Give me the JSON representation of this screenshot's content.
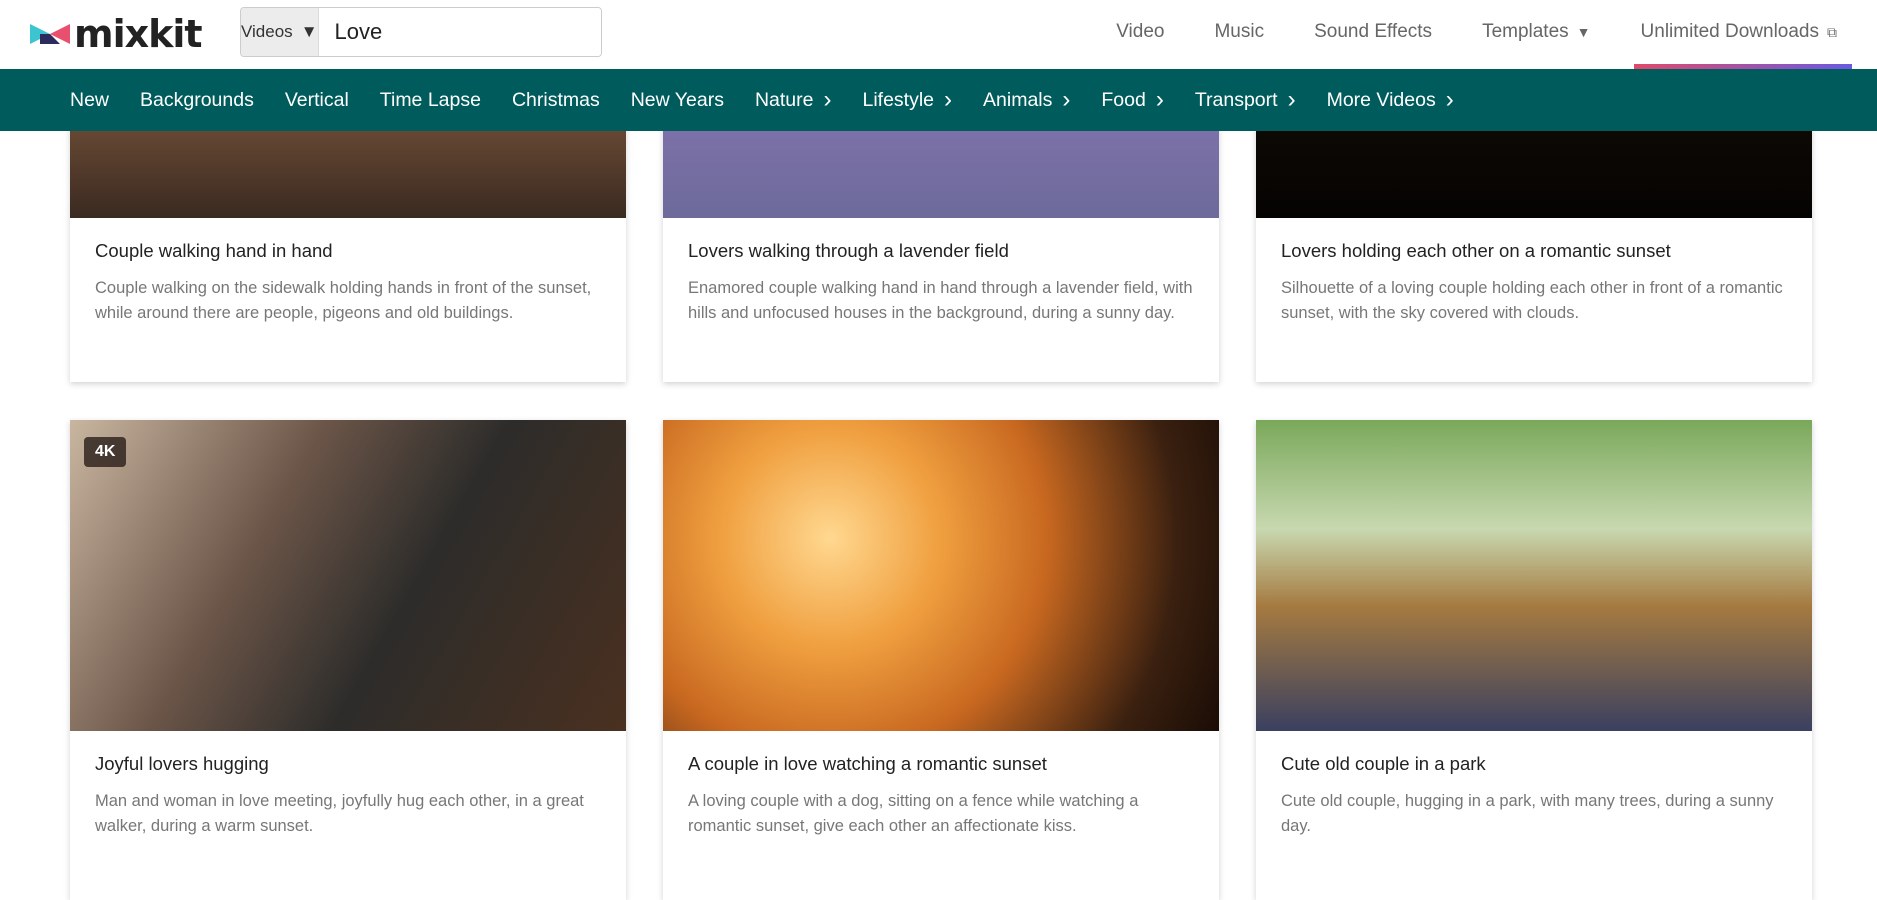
{
  "header": {
    "logo": "mixkit",
    "search": {
      "type": "Videos",
      "value": "Love"
    },
    "nav": [
      {
        "label": "Video"
      },
      {
        "label": "Music"
      },
      {
        "label": "Sound Effects"
      },
      {
        "label": "Templates"
      },
      {
        "label": "Unlimited Downloads"
      }
    ]
  },
  "categories": [
    "New",
    "Backgrounds",
    "Vertical",
    "Time Lapse",
    "Christmas",
    "New Years",
    "Nature",
    "Lifestyle",
    "Animals",
    "Food",
    "Transport",
    "More Videos"
  ],
  "cards": [
    {
      "title": "Couple walking hand in hand",
      "desc": "Couple walking on the sidewalk holding hands in front of the sunset, while around there are people, pigeons and old buildings."
    },
    {
      "title": "Lovers walking through a lavender field",
      "desc": "Enamored couple walking hand in hand through a lavender field, with hills and unfocused houses in the background, during a sunny day."
    },
    {
      "title": "Lovers holding each other on a romantic sunset",
      "desc": "Silhouette of a loving couple holding each other in front of a romantic sunset, with the sky covered with clouds."
    },
    {
      "title": "Joyful lovers hugging",
      "desc": "Man and woman in love meeting, joyfully hug each other, in a great walker, during a warm sunset.",
      "badge": "4K"
    },
    {
      "title": "A couple in love watching a romantic sunset",
      "desc": "A loving couple with a dog, sitting on a fence while watching a romantic sunset, give each other an affectionate kiss."
    },
    {
      "title": "Cute old couple in a park",
      "desc": "Cute old couple, hugging in a park, with many trees, during a sunny day."
    }
  ],
  "colors": {
    "nav_bg": "#005c5c",
    "accent_start": "#e04a6a",
    "accent_end": "#6a5ae0"
  }
}
